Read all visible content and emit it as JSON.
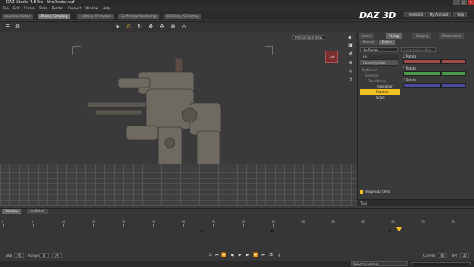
{
  "window": {
    "title": "DAZ Studio 4.6 Pro - theDenier.duf"
  },
  "menu": [
    "File",
    "Edit",
    "Create",
    "Tools",
    "Render",
    "Connect",
    "Window",
    "Help"
  ],
  "room_tabs": [
    {
      "label": "Learning Center",
      "active": false
    },
    {
      "label": "Posing / Shaping",
      "active": true
    },
    {
      "label": "Lighting / Cameras",
      "active": false
    },
    {
      "label": "Surfacing / Rendering",
      "active": false
    },
    {
      "label": "Building / Sculpting",
      "active": false
    }
  ],
  "top_buttons": {
    "feedback": "Feedback",
    "my_account": "My Account",
    "help": "Help"
  },
  "brand": {
    "logo_text": "DAZ 3D"
  },
  "viewport": {
    "camera_label": "Perspective View",
    "cube_face": "Left"
  },
  "panel_tabs": [
    {
      "label": "Scene",
      "active": false
    },
    {
      "label": "Posing",
      "active": true
    },
    {
      "label": "Shaping",
      "active": false
    },
    {
      "label": "Parameters",
      "active": false
    }
  ],
  "posing_panel": {
    "subtabs": [
      "Presets",
      "Editor"
    ],
    "scene_select": "theDenier",
    "scene_list": [
      {
        "label": "All",
        "selected": false
      },
      {
        "label": "Currently Used",
        "selected": true
      }
    ],
    "tree": [
      {
        "label": "theDenier",
        "indent": 0,
        "highlight": false
      },
      {
        "label": "General",
        "indent": 1,
        "highlight": false
      },
      {
        "label": "Transforms",
        "indent": 2,
        "highlight": false
      },
      {
        "label": "Translation",
        "indent": 3,
        "highlight": false
      },
      {
        "label": "Rotation",
        "indent": 3,
        "highlight": true
      },
      {
        "label": "Scale",
        "indent": 3,
        "highlight": false
      }
    ],
    "search_placeholder": "Enter text to filter by...",
    "properties": [
      {
        "label": "X Rotate",
        "color": "#a04a4a",
        "value": "0.00",
        "knob": 0.6
      },
      {
        "label": "Y Rotate",
        "color": "#4a9a4a",
        "value": "0.00",
        "knob": 0.6
      },
      {
        "label": "Z Rotate",
        "color": "#4a4aa0",
        "value": "0.00",
        "knob": 0.6
      }
    ],
    "show_sub_items": "Show Sub Items",
    "tips": "Tips"
  },
  "timeline": {
    "tabs": [
      {
        "label": "Timeline",
        "active": true
      },
      {
        "label": "aniMate2",
        "active": false
      }
    ],
    "ticks": [
      0,
      5,
      10,
      15,
      20,
      25,
      30,
      35,
      40,
      45,
      50,
      55,
      60,
      65,
      70,
      75
    ],
    "total_label": "Total",
    "total_value": "76",
    "range_label": "Range",
    "range_start": "0",
    "range_end": "76",
    "current_label": "Current",
    "current_value": "66",
    "fps_label": "FPS",
    "fps_value": "30",
    "scrubber_frame": 66,
    "max_frame": 78
  },
  "status": {
    "lesson_placeholder": "Select a Lesson...",
    "progress": 0.0
  },
  "colors": {
    "accent": "#f0c020",
    "panel": "#3a3a3a"
  }
}
